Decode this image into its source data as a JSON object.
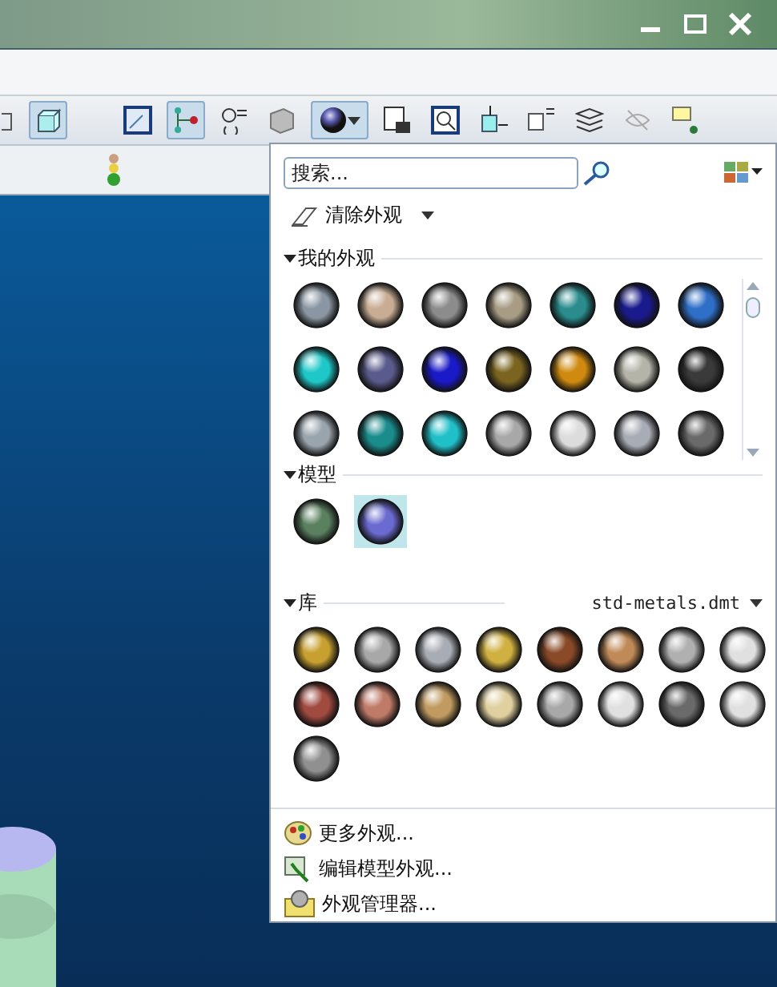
{
  "search": {
    "placeholder": "搜索..."
  },
  "clear_button": {
    "label": "清除外观"
  },
  "my_appearances": {
    "title": "我的外观",
    "items": [
      {
        "color": "#8a96a3",
        "selected": false
      },
      {
        "color": "#c8ad94",
        "selected": false
      },
      {
        "color": "#8c8c8c",
        "selected": false
      },
      {
        "color": "#a89c84",
        "selected": false
      },
      {
        "color": "#2a8c8c",
        "selected": false
      },
      {
        "color": "#1a1a8c",
        "selected": false
      },
      {
        "color": "#2f6fc8",
        "selected": false
      },
      {
        "color": "#1fc8c8",
        "selected": false
      },
      {
        "color": "#5a5a8c",
        "selected": false
      },
      {
        "color": "#1a1ac8",
        "selected": false
      },
      {
        "color": "#7a6420",
        "selected": false
      },
      {
        "color": "#d08a10",
        "selected": false
      },
      {
        "color": "#b4b4a8",
        "selected": false
      },
      {
        "color": "#3a3a3a",
        "selected": false
      },
      {
        "color": "#9aa4ac",
        "selected": false
      },
      {
        "color": "#1a8c8c",
        "selected": false
      },
      {
        "color": "#20c0c8",
        "selected": false
      },
      {
        "color": "#a8a8a8",
        "selected": false
      },
      {
        "color": "#dcdcdc",
        "selected": false
      },
      {
        "color": "#a8acb4",
        "selected": false
      },
      {
        "color": "#6a6a6a",
        "selected": false
      }
    ]
  },
  "model": {
    "title": "模型",
    "items": [
      {
        "color": "#5a8060",
        "selected": false
      },
      {
        "color": "#6a6ad0",
        "selected": true
      }
    ]
  },
  "library": {
    "title": "库",
    "file": "std-metals.dmt",
    "items": [
      {
        "color": "#c8a030",
        "selected": false
      },
      {
        "color": "#a8a8a8",
        "selected": false
      },
      {
        "color": "#a8acb4",
        "selected": false
      },
      {
        "color": "#d0b040",
        "selected": false
      },
      {
        "color": "#8a4a28",
        "selected": false
      },
      {
        "color": "#c08a58",
        "selected": false
      },
      {
        "color": "#b0b0b0",
        "selected": false
      },
      {
        "color": "#e0e0e0",
        "selected": false
      },
      {
        "color": "#a04a40",
        "selected": false
      },
      {
        "color": "#c07a68",
        "selected": false
      },
      {
        "color": "#c09a60",
        "selected": false
      },
      {
        "color": "#e0d0a0",
        "selected": false
      },
      {
        "color": "#a8a8a8",
        "selected": false
      },
      {
        "color": "#e0e0e0",
        "selected": false
      },
      {
        "color": "#6a6a6a",
        "selected": false
      },
      {
        "color": "#e0e0e0",
        "selected": false
      },
      {
        "color": "#909090",
        "selected": false
      }
    ]
  },
  "menu": [
    {
      "label": "更多外观...",
      "kind": "palette"
    },
    {
      "label": "编辑模型外观...",
      "kind": "edit"
    },
    {
      "label": "外观管理器...",
      "kind": "manager"
    }
  ]
}
